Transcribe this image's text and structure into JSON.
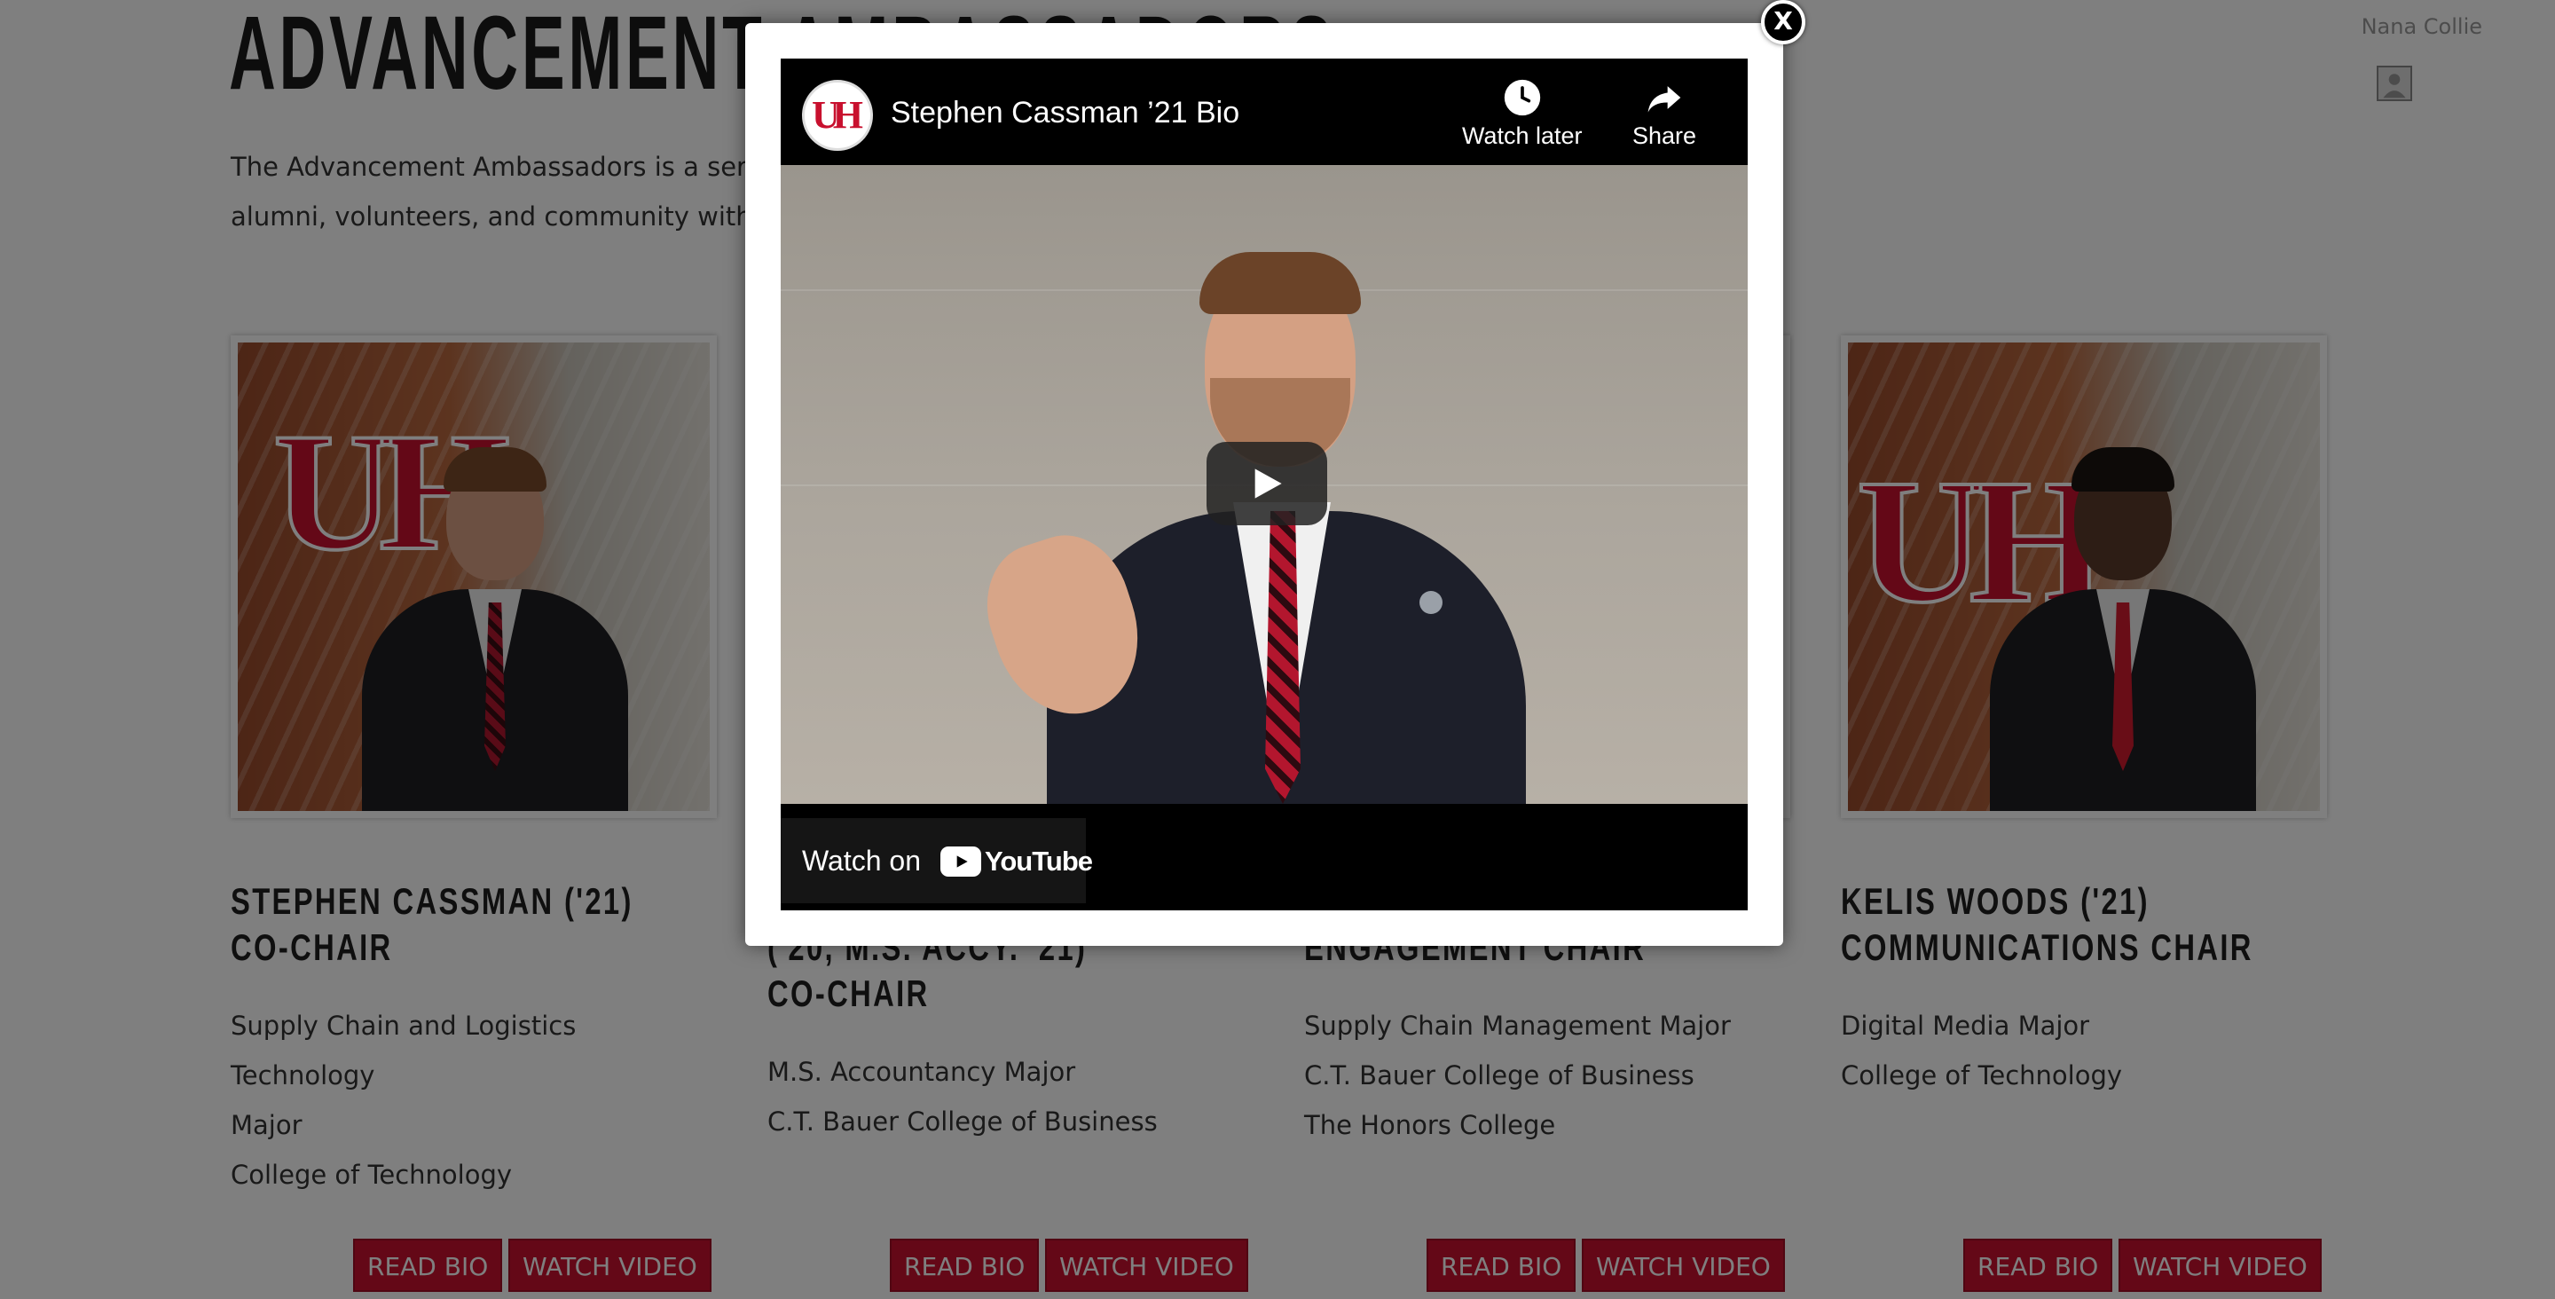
{
  "page": {
    "title": "ADVANCEMENT AMBASSADORS",
    "intro_line1": "The Advancement Ambassadors is a service-focused student organization . Their mission is to connect UH donors,",
    "intro_line2": "alumni, volunteers, and community with students, support programs, and develop future Cougar leaders.",
    "user_name": "Nana Collie"
  },
  "cards": [
    {
      "name_line1": "STEPHEN CASSMAN ('21)",
      "name_line2": "CO-CHAIR",
      "name_line3": "",
      "details": [
        "Supply Chain and Logistics Technology",
        "Major",
        "College of Technology"
      ],
      "read_bio": "READ BIO",
      "watch_video": "WATCH VIDEO"
    },
    {
      "name_line1": "",
      "name_line2": "('20, M.S. ACCY. '21)",
      "name_line3": "CO-CHAIR",
      "details": [
        "M.S. Accountancy Major",
        "C.T. Bauer College of Business"
      ],
      "read_bio": "READ BIO",
      "watch_video": "WATCH VIDEO"
    },
    {
      "name_line1": "",
      "name_line2": "ENGAGEMENT CHAIR",
      "name_line3": "",
      "details": [
        "Supply Chain Management Major",
        "C.T. Bauer College of Business",
        "The Honors College"
      ],
      "read_bio": "READ BIO",
      "watch_video": "WATCH VIDEO"
    },
    {
      "name_line1": "KELIS WOODS ('21)",
      "name_line2": "COMMUNICATIONS CHAIR",
      "name_line3": "",
      "details": [
        "Digital Media Major",
        "College of Technology"
      ],
      "read_bio": "READ BIO",
      "watch_video": "WATCH VIDEO"
    }
  ],
  "modal": {
    "close_label": "X",
    "video": {
      "title": "Stephen Cassman ’21 Bio",
      "channel_logo_text": "UH",
      "watch_later": "Watch later",
      "share": "Share",
      "watch_on": "Watch on",
      "youtube_word": "YouTube"
    }
  },
  "colors": {
    "brand_red": "#c8102e",
    "overlay": "rgba(0,0,0,0.5)",
    "player_black": "#000000"
  },
  "icons": [
    "clock-icon",
    "share-arrow-icon",
    "play-icon",
    "youtube-logo-icon",
    "close-icon",
    "avatar-icon"
  ]
}
